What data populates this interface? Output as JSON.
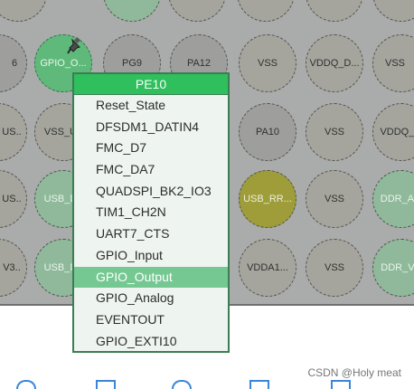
{
  "pins": {
    "r1": [
      "",
      "",
      "",
      "",
      "",
      "",
      ""
    ],
    "r2": [
      "6",
      "GPIO_O...",
      "PG9",
      "PA12",
      "VSS",
      "VDDQ_D...",
      "VSS"
    ],
    "r3": [
      "US..",
      "VSS_U..",
      "",
      "",
      "PA10",
      "VSS",
      "VDDQ_..."
    ],
    "r4": [
      "US..",
      "USB_D..",
      "",
      "",
      "USB_RR...",
      "VSS",
      "DDR_A..."
    ],
    "r5": [
      "V3..",
      "USB_D..",
      "",
      "",
      "VDDA1...",
      "VSS",
      "DDR_V..."
    ]
  },
  "menu": {
    "title": "PE10",
    "items": [
      "Reset_State",
      "DFSDM1_DATIN4",
      "FMC_D7",
      "FMC_DA7",
      "QUADSPI_BK2_IO3",
      "TIM1_CH2N",
      "UART7_CTS",
      "GPIO_Input",
      "GPIO_Output",
      "GPIO_Analog",
      "EVENTOUT",
      "GPIO_EXTI10"
    ],
    "selected_index": 8
  },
  "watermark": "CSDN @Holy meat",
  "colors": {
    "board_bg": "#a9acaa",
    "pin_green": "#5fb97a",
    "pin_olive": "#9e9d3a",
    "menu_header": "#2fbf5d",
    "menu_selected": "#75c892"
  }
}
